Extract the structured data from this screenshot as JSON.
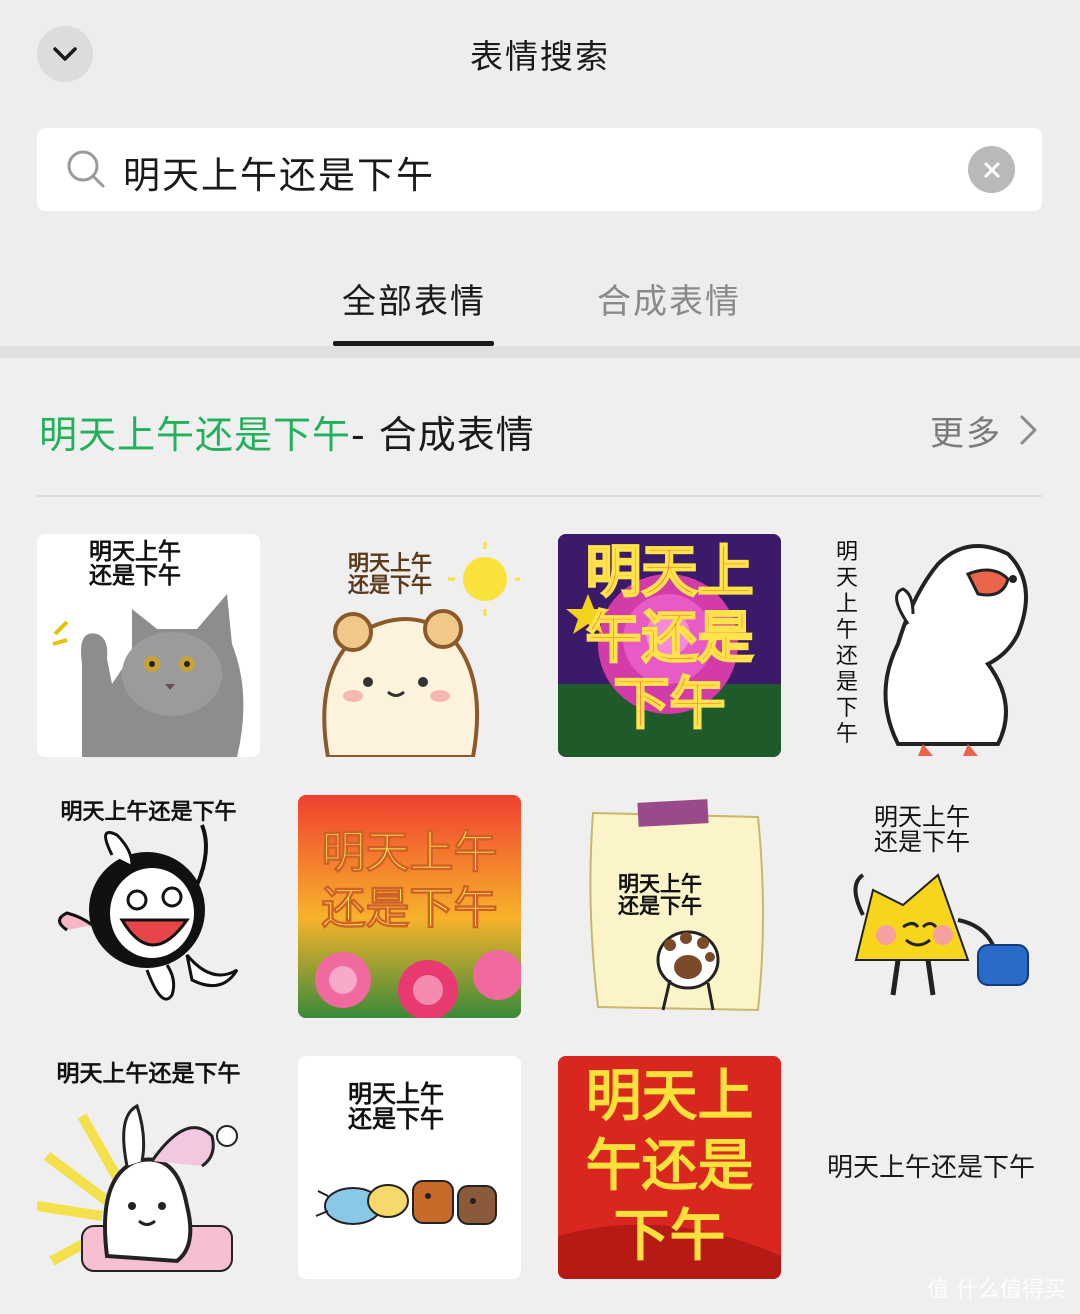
{
  "header": {
    "title": "表情搜索"
  },
  "search": {
    "query": "明天上午还是下午"
  },
  "tabs": [
    {
      "label": "全部表情",
      "active": true
    },
    {
      "label": "合成表情",
      "active": false
    }
  ],
  "section": {
    "keyword": "明天上午还是下午",
    "suffix": "- 合成表情",
    "more_label": "更多"
  },
  "stickers": [
    {
      "caption": "明天上午\n还是下午",
      "subject": "grey-cat-waving"
    },
    {
      "caption": "明天上午\n还是下午",
      "subject": "hamster-with-sun"
    },
    {
      "caption": "明天上\n午还是\n下午",
      "subject": "purple-rose"
    },
    {
      "caption": "明天上午还是下午",
      "subject": "white-duck"
    },
    {
      "caption": "明天上午还是下午",
      "subject": "laughing-bunny"
    },
    {
      "caption": "明天上午\n还是下午",
      "subject": "peony-flowers"
    },
    {
      "caption": "明天上午\n还是下午",
      "subject": "note-with-paw"
    },
    {
      "caption": "明天上午\n还是下午",
      "subject": "yellow-blob-with-bag"
    },
    {
      "caption": "明天上午还是下午",
      "subject": "sleepy-rabbit"
    },
    {
      "caption": "明天上午\n还是下午",
      "subject": "running-animals"
    },
    {
      "caption": "明天上\n午还是\n下午",
      "subject": "red-banner"
    },
    {
      "caption": "明天上午还是下午",
      "subject": "text-only"
    }
  ],
  "colors": {
    "accent": "#21b15a",
    "background": "#ededed"
  },
  "watermark": "值 什么值得买"
}
